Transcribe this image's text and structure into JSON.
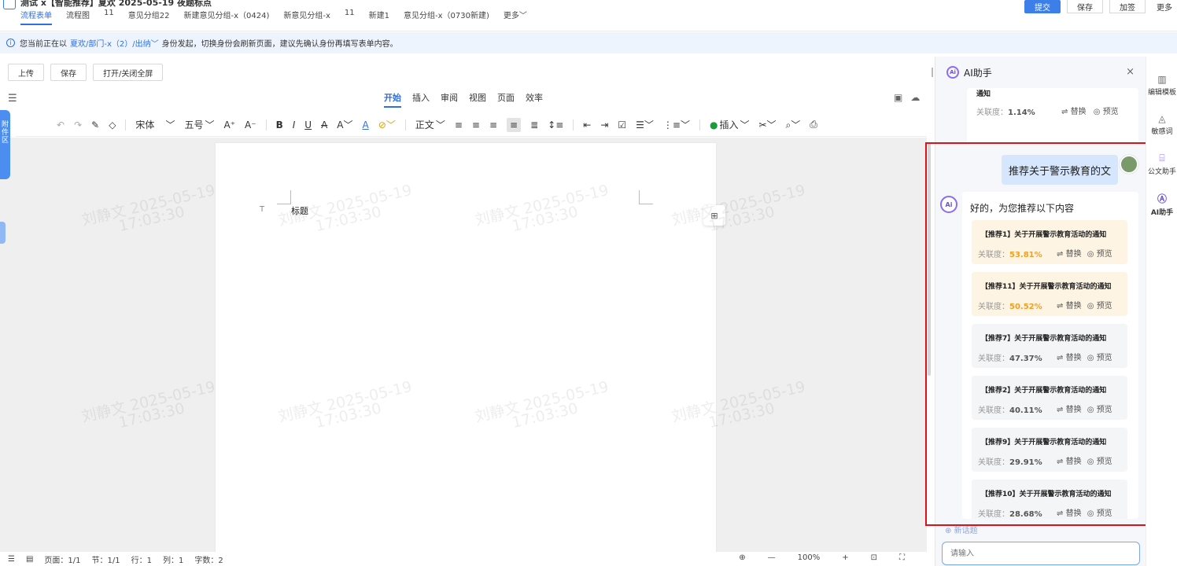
{
  "header": {
    "doc_title": "测试 x【智能推荐】夏欢 2025-05-19 夜题标点",
    "nav": [
      "流程表单",
      "流程图",
      "11",
      "意见分组22",
      "新建意见分组-x（0424)",
      "新意见分组-x",
      "11",
      "新建1",
      "意见分组-x（0730新建)",
      "更多"
    ],
    "submit": "提交",
    "save": "保存",
    "countersign": "加签",
    "more": "更多"
  },
  "notice": {
    "prefix": "您当前正在以",
    "role": "夏欢/部门-x（2）/出纳",
    "suffix": "身份发起，切换身份会刷新页面，建议先确认身份再填写表单内容。"
  },
  "doc_actions": [
    "上传",
    "保存",
    "打开/关闭全屏"
  ],
  "menu_tabs": [
    "开始",
    "插入",
    "审阅",
    "视图",
    "页面",
    "效率"
  ],
  "format_bar": {
    "font": "宋体",
    "size": "五号",
    "style": "正文",
    "insert": "插入"
  },
  "attach_tab": "附件区",
  "page": {
    "title": "标题"
  },
  "watermark": {
    "name": "刘静文",
    "date": "2025-05-19",
    "time": "17:03:30"
  },
  "status": {
    "page": "页面：1/1",
    "section": "节：1/1",
    "row": "行：1",
    "col": "列：1",
    "words": "字数：2",
    "zoom": "100%"
  },
  "ai": {
    "title": "AI助手",
    "prev_title": "通知",
    "prev_rel_label": "关联度：",
    "prev_rel": "1.14%",
    "replace": "替换",
    "preview": "预览",
    "user_msg": "推荐关于警示教育的文",
    "greet": "好的，为您推荐以下内容",
    "rel_label": "关联度：",
    "recommendations": [
      {
        "title": "【推荐1】关于开展警示教育活动的通知",
        "rel": "53.81%",
        "hot": true
      },
      {
        "title": "【推荐11】关于开展警示教育活动的通知",
        "rel": "50.52%",
        "hot": true
      },
      {
        "title": "【推荐7】关于开展警示教育活动的通知",
        "rel": "47.37%",
        "hot": false
      },
      {
        "title": "【推荐2】关于开展警示教育活动的通知",
        "rel": "40.11%",
        "hot": false
      },
      {
        "title": "【推荐9】关于开展警示教育活动的通知",
        "rel": "29.91%",
        "hot": false
      },
      {
        "title": "【推荐10】关于开展警示教育活动的通知",
        "rel": "28.68%",
        "hot": false
      }
    ],
    "new_topic": "新话题",
    "input_placeholder": "请输入"
  },
  "rail": [
    "编辑模板",
    "敏感词",
    "公文助手",
    "AI助手"
  ],
  "colors": {
    "accent": "#2f6fe4",
    "highlight": "#e0101a",
    "hot": "#f0a020"
  }
}
